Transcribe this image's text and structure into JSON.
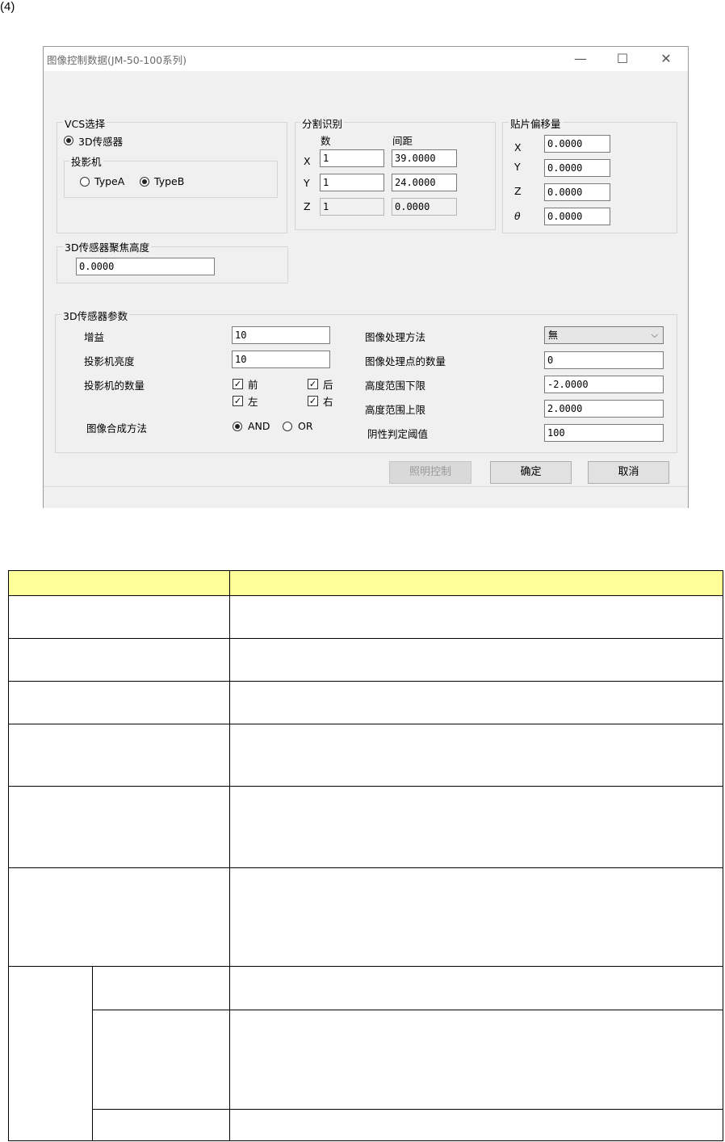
{
  "page_label": "(4)",
  "window": {
    "title": "图像控制数据(JM-50-100系列)",
    "minimize": "—",
    "maximize": "☐",
    "close": "✕"
  },
  "vcs": {
    "group_label": "VCS选择",
    "sensor_option": "3D传感器",
    "projector_label": "投影机",
    "type_a": "TypeA",
    "type_b": "TypeB"
  },
  "split": {
    "group_label": "分割识别",
    "col_count": "数",
    "col_pitch": "间距",
    "rows": [
      {
        "axis": "X",
        "count": "1",
        "pitch": "39.0000"
      },
      {
        "axis": "Y",
        "count": "1",
        "pitch": "24.0000"
      },
      {
        "axis": "Z",
        "count": "1",
        "pitch": "0.0000"
      }
    ]
  },
  "offset": {
    "group_label": "贴片偏移量",
    "rows": [
      {
        "axis": "X",
        "value": "0.0000"
      },
      {
        "axis": "Y",
        "value": "0.0000"
      },
      {
        "axis": "Z",
        "value": "0.0000"
      },
      {
        "axis": "θ",
        "value": "0.0000"
      }
    ]
  },
  "focus": {
    "group_label": "3D传感器聚焦高度",
    "value": "0.0000"
  },
  "params": {
    "group_label": "3D传感器参数",
    "gain_label": "增益",
    "gain_value": "10",
    "brightness_label": "投影机亮度",
    "brightness_value": "10",
    "count_label": "投影机的数量",
    "front": "前",
    "back": "后",
    "left": "左",
    "right": "右",
    "compose_label": "图像合成方法",
    "and": "AND",
    "or": "OR",
    "method_label": "图像处理方法",
    "method_value": "無",
    "points_label": "图像处理点的数量",
    "points_value": "0",
    "lower_label": "高度范围下限",
    "lower_value": "-2.0000",
    "upper_label": "高度范围上限",
    "upper_value": "2.0000",
    "threshold_label": "阴性判定阈值",
    "threshold_value": "100"
  },
  "buttons": {
    "lighting": "照明控制",
    "ok": "确定",
    "cancel": "取消"
  },
  "colors": {
    "header_fill": "#ffff99",
    "dialog_bg": "#f0f0f0"
  }
}
